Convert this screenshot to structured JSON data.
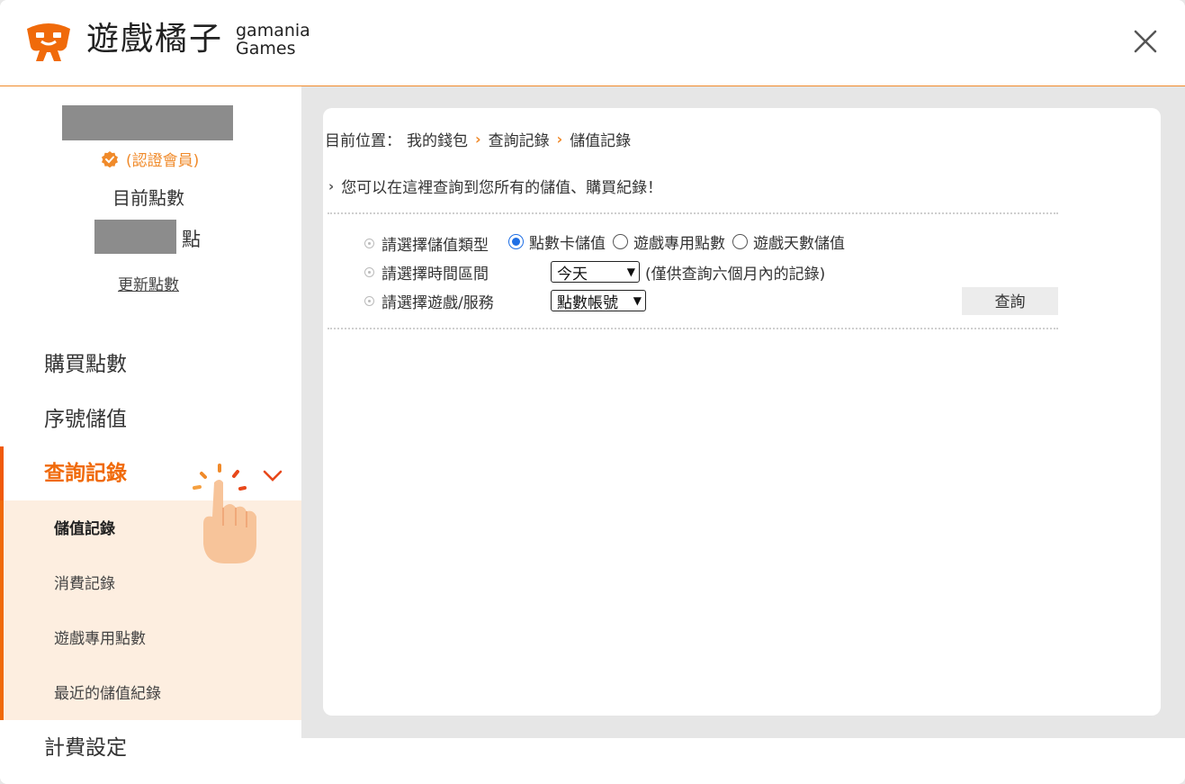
{
  "header": {
    "brand_cn": "遊戲橘子",
    "brand_en_line1": "gamania",
    "brand_en_line2": "Games",
    "logo_icon": "gamania-logo-icon",
    "close_icon": "close-icon"
  },
  "user": {
    "verified_label": "(認證會員)",
    "points_label": "目前點數",
    "points_unit": "點",
    "refresh_label": "更新點數"
  },
  "nav": {
    "items": [
      {
        "label": "購買點數"
      },
      {
        "label": "序號儲值"
      },
      {
        "label": "查詢記錄"
      },
      {
        "label": "計費設定"
      }
    ],
    "sub_items": [
      {
        "label": "儲值記錄"
      },
      {
        "label": "消費記錄"
      },
      {
        "label": "遊戲專用點數"
      },
      {
        "label": "最近的儲值紀錄"
      }
    ]
  },
  "main": {
    "breadcrumb": {
      "prefix": "目前位置：",
      "crumbs": [
        "我的錢包",
        "查詢記錄",
        "儲值記錄"
      ]
    },
    "intro": "您可以在這裡查詢到您所有的儲值、購買紀錄！",
    "form": {
      "type_label": "請選擇儲值類型",
      "type_options": [
        "點數卡儲值",
        "遊戲專用點數",
        "遊戲天數儲值"
      ],
      "time_label": "請選擇時間區間",
      "time_value": "今天",
      "time_note": "(僅供查詢六個月內的記錄)",
      "service_label": "請選擇遊戲/服務",
      "service_value": "點數帳號",
      "query_button": "查詢"
    }
  },
  "colors": {
    "accent": "#f08a2a",
    "active": "#f06a0a",
    "submenu_bg": "#fdeee0",
    "radio": "#1f6fe5"
  }
}
